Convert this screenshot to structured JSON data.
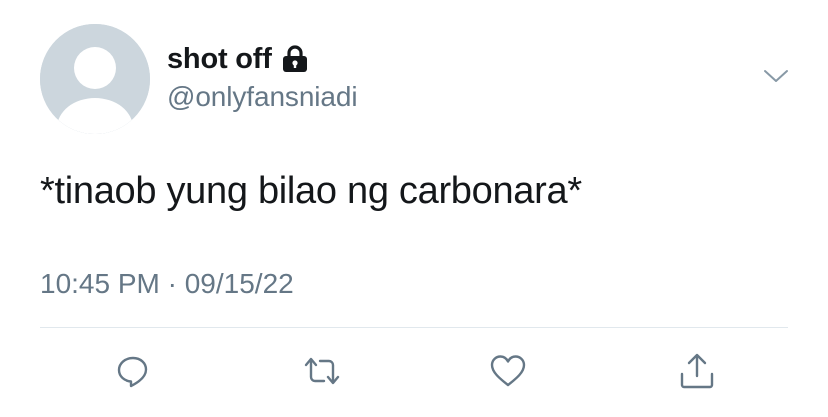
{
  "author": {
    "display_name": "shot off",
    "handle": "@onlyfansniadi",
    "protected_icon": "lock-icon",
    "avatar_icon": "default-avatar-icon"
  },
  "menu": {
    "icon": "chevron-down-icon"
  },
  "tweet": {
    "text": "*tinaob yung bilao ng carbonara*",
    "timestamp": "10:45 PM · 09/15/22"
  },
  "actions": [
    {
      "name": "reply",
      "icon": "reply-icon"
    },
    {
      "name": "retweet",
      "icon": "retweet-icon"
    },
    {
      "name": "like",
      "icon": "heart-icon"
    },
    {
      "name": "share",
      "icon": "share-icon"
    }
  ],
  "colors": {
    "text_primary": "#14171a",
    "text_secondary": "#657786",
    "icon": "#657786",
    "avatar_bg": "#ccd6dd",
    "divider": "#e1e8ed"
  }
}
